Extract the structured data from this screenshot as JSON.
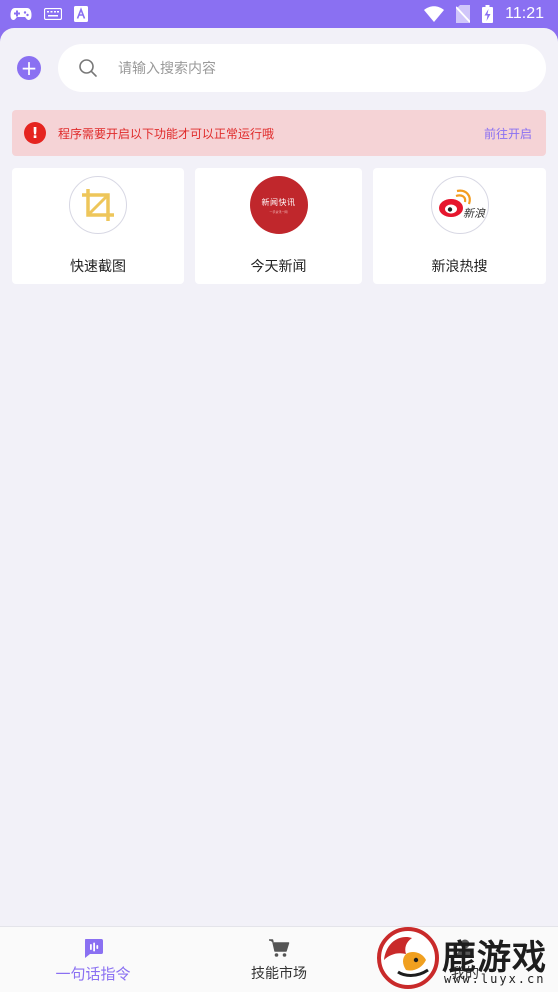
{
  "status_bar": {
    "time": "11:21",
    "left_icons": [
      "gamepad-icon",
      "keyboard-icon",
      "a-box-icon"
    ],
    "right_icons": [
      "wifi-icon",
      "no-sim-icon",
      "battery-charging-icon"
    ]
  },
  "search": {
    "add_label": "+",
    "placeholder": "请输入搜索内容"
  },
  "warning": {
    "icon": "!",
    "message": "程序需要开启以下功能才可以正常运行哦",
    "action": "前往开启"
  },
  "cards": [
    {
      "label": "快速截图",
      "icon": "crop-icon"
    },
    {
      "label": "今天新闻",
      "icon": "news-logo-icon",
      "logo_text": "新闻快讯",
      "logo_subtext": "一手资讯一网"
    },
    {
      "label": "新浪热搜",
      "icon": "sina-weibo-icon",
      "logo_text": "新浪"
    }
  ],
  "bottom_nav": {
    "items": [
      {
        "label": "一句话指令",
        "icon": "voice-command-icon",
        "active": true
      },
      {
        "label": "技能市场",
        "icon": "cart-icon",
        "active": false
      },
      {
        "label": "我的",
        "icon": "user-icon",
        "active": false
      }
    ]
  },
  "watermark": {
    "text": "鹿游戏",
    "url": "www.luyx.cn"
  },
  "colors": {
    "accent": "#8a70f2",
    "warning_bg": "#f5d3d6",
    "warning_text": "#e02b2b",
    "background": "#f2f1f8"
  }
}
